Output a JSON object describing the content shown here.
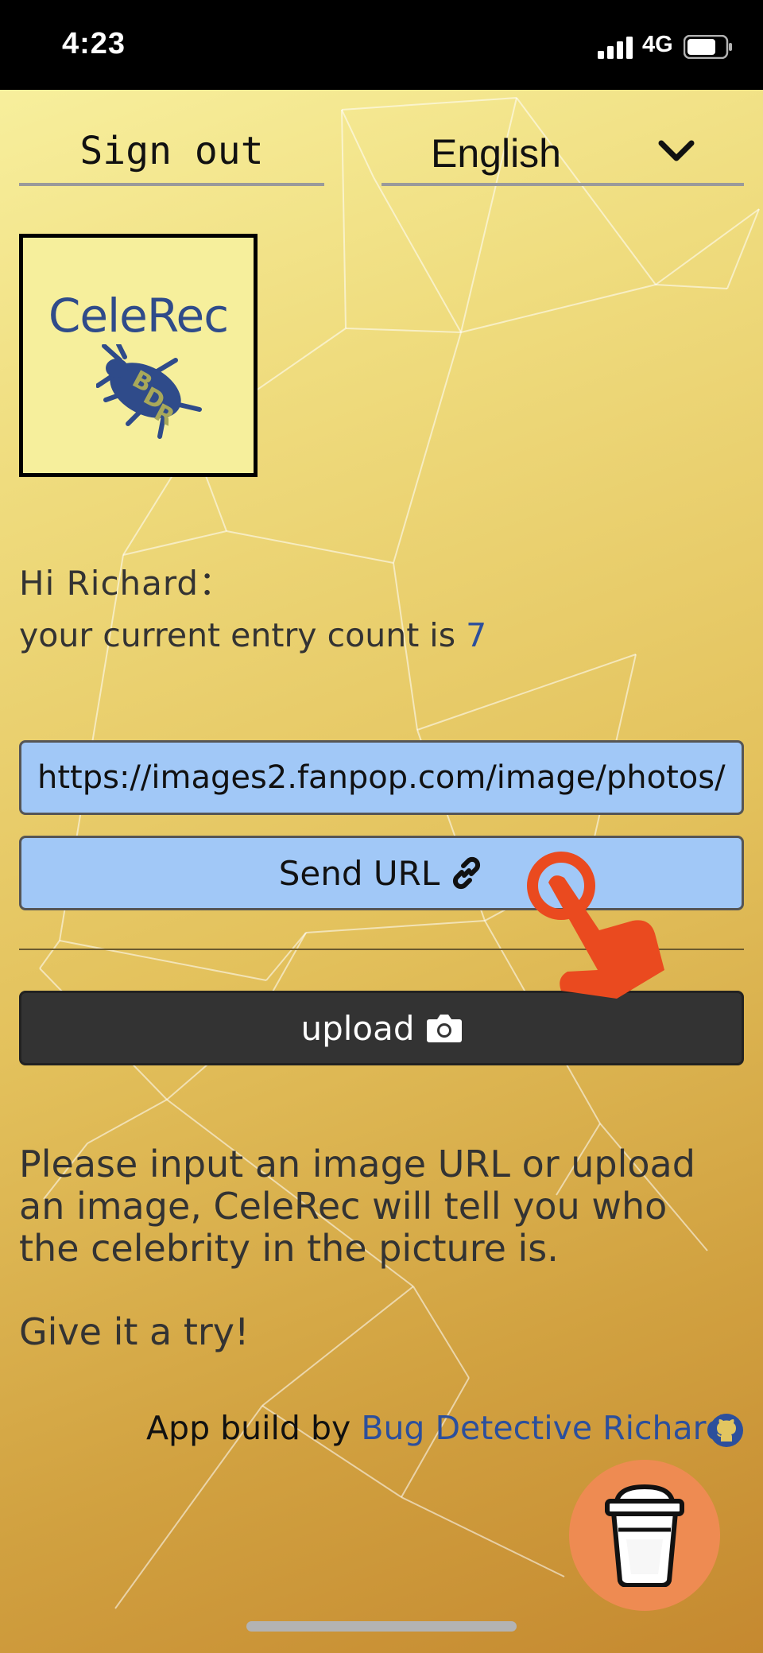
{
  "status_bar": {
    "time": "4:23",
    "network": "4G",
    "battery_level": 0.75
  },
  "header": {
    "signout_label": "Sign out",
    "language": "English"
  },
  "logo": {
    "text": "CeleRec"
  },
  "greeting": {
    "hello": "Hi Richard：",
    "count_prefix": "your current entry count is ",
    "count": "7"
  },
  "url_input": {
    "value": "https://images2.fanpop.com/image/photos/"
  },
  "send_button": {
    "label": "Send URL"
  },
  "upload_button": {
    "label": "upload"
  },
  "description": {
    "text": "Please input an image URL or upload an image, CeleRec will tell you who the celebrity in the picture is.",
    "try": "Give it a try!"
  },
  "footer": {
    "prefix": "App build by ",
    "author": "Bug Detective Richard"
  },
  "colors": {
    "input_bg": "#a1c8f7",
    "accent_blue": "#2c4f9c",
    "upload_bg": "#333333",
    "coffee_bg": "#ee8b52",
    "hand": "#ea4a1f"
  },
  "icons": [
    "signal-icon",
    "battery-icon",
    "chevron-down-icon",
    "link-icon",
    "camera-icon",
    "github-icon",
    "coffee-cup-icon",
    "tap-hand-icon"
  ]
}
